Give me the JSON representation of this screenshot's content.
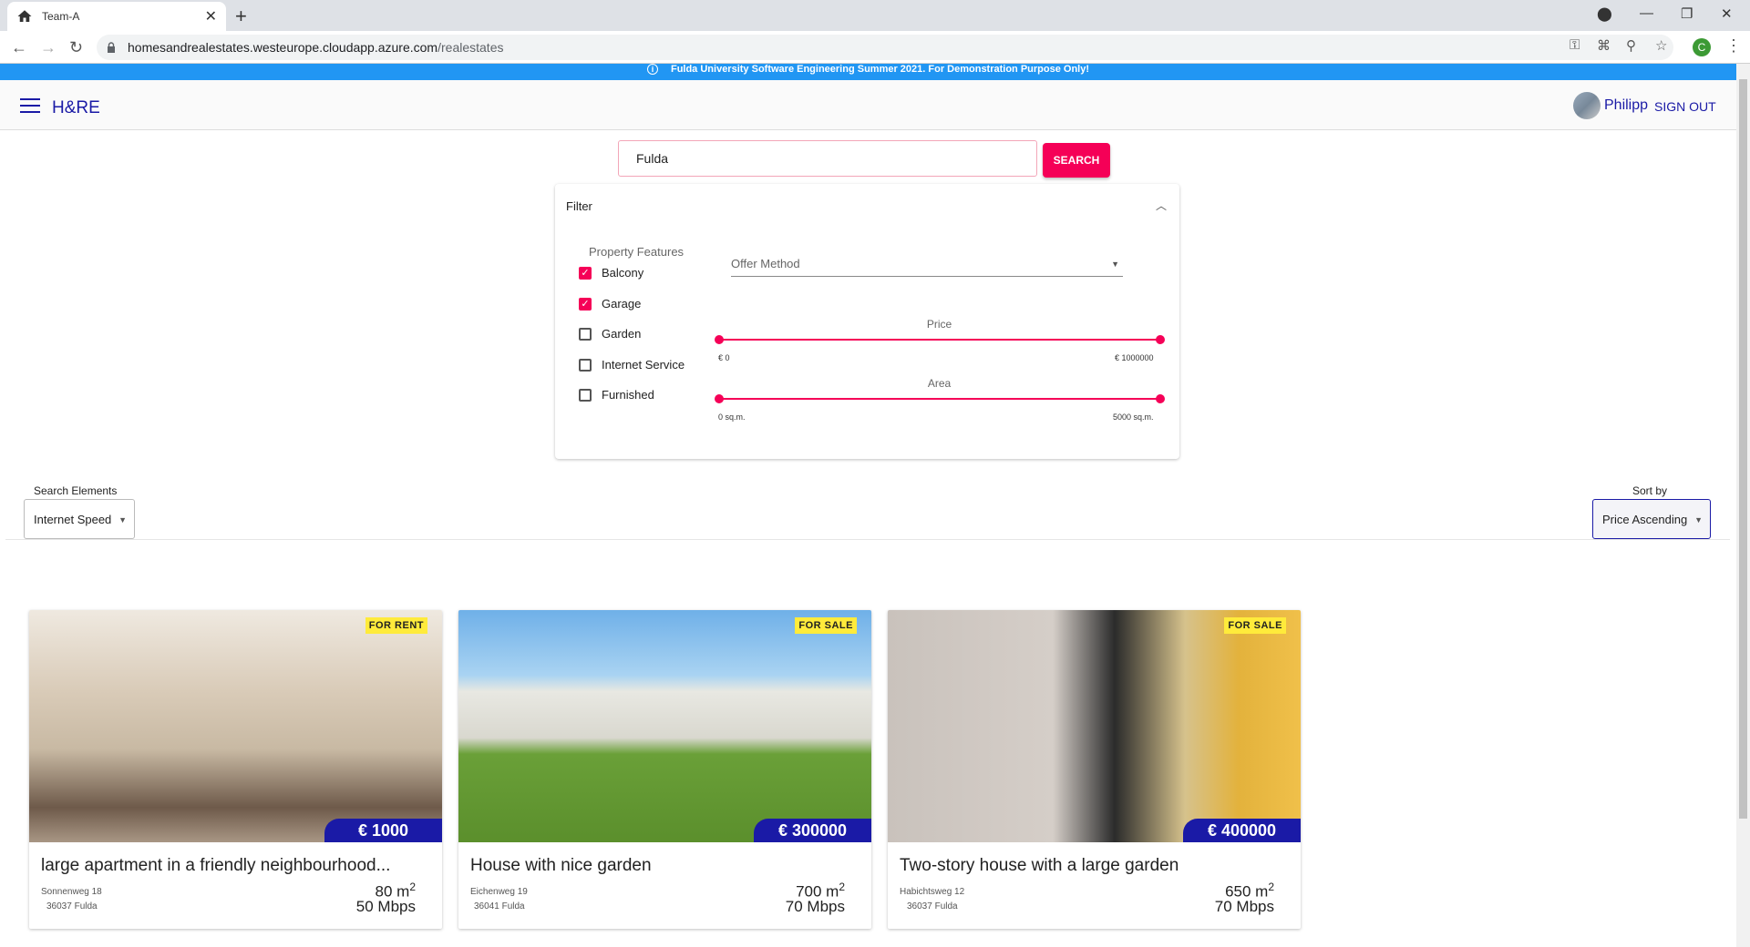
{
  "browser": {
    "tab_title": "Team-A",
    "url_host": "homesandrealestates.westeurope.cloudapp.azure.com",
    "url_path": "/realestates",
    "profile_initial": "C"
  },
  "banner": {
    "text": "Fulda University Software Engineering Summer 2021. For Demonstration Purpose Only!"
  },
  "header": {
    "brand": "H&RE",
    "username": "Philipp",
    "signout_label": "SIGN OUT"
  },
  "search": {
    "value": "Fulda",
    "button_label": "SEARCH"
  },
  "filter": {
    "title": "Filter",
    "features_label": "Property Features",
    "features": [
      {
        "label": "Balcony",
        "checked": true
      },
      {
        "label": "Garage",
        "checked": true
      },
      {
        "label": "Garden",
        "checked": false
      },
      {
        "label": "Internet Service",
        "checked": false
      },
      {
        "label": "Furnished",
        "checked": false
      }
    ],
    "offer_method_placeholder": "Offer Method",
    "price": {
      "label": "Price",
      "min_label": "€ 0",
      "max_label": "€ 1000000"
    },
    "area": {
      "label": "Area",
      "min_label": "0 sq.m.",
      "max_label": "5000 sq.m."
    }
  },
  "toolbar": {
    "search_elements_label": "Search Elements",
    "search_elements_value": "Internet Speed",
    "sort_label": "Sort by",
    "sort_value": "Price Ascending"
  },
  "listings": [
    {
      "badge": "FOR RENT",
      "price": "€ 1000",
      "title": "large apartment in a friendly neighbourhood...",
      "street": "Sonnenweg 18",
      "city": "36037 Fulda",
      "area": "80 m",
      "internet": "50 Mbps"
    },
    {
      "badge": "FOR SALE",
      "price": "€ 300000",
      "title": "House with nice garden",
      "street": "Eichenweg 19",
      "city": "36041 Fulda",
      "area": "700 m",
      "internet": "70 Mbps"
    },
    {
      "badge": "FOR SALE",
      "price": "€ 400000",
      "title": "Two-story house with a large garden",
      "street": "Habichtsweg 12",
      "city": "36037 Fulda",
      "area": "650 m",
      "internet": "70 Mbps"
    }
  ],
  "colors": {
    "accent": "#f50057",
    "brand": "#1a1aa6",
    "banner": "#2196f3",
    "badge": "#ffeb3b"
  }
}
